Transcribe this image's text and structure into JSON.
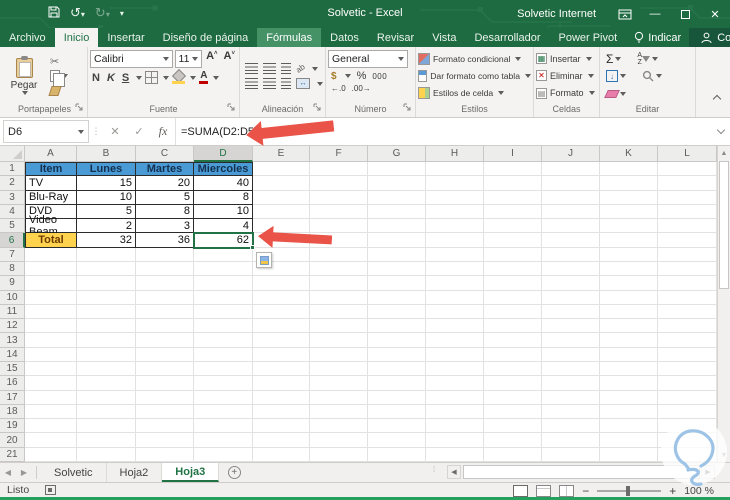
{
  "titlebar": {
    "title": "Solvetic - Excel",
    "account": "Solvetic Internet"
  },
  "ribbon_tabs": [
    {
      "label": "Archivo",
      "state": "file"
    },
    {
      "label": "Inicio",
      "state": "active"
    },
    {
      "label": "Insertar",
      "state": "normal"
    },
    {
      "label": "Diseño de página",
      "state": "normal"
    },
    {
      "label": "Fórmulas",
      "state": "highlight"
    },
    {
      "label": "Datos",
      "state": "normal"
    },
    {
      "label": "Revisar",
      "state": "normal"
    },
    {
      "label": "Vista",
      "state": "normal"
    },
    {
      "label": "Desarrollador",
      "state": "normal"
    },
    {
      "label": "Power Pivot",
      "state": "normal"
    }
  ],
  "tell_me": "Indicar",
  "share": "Compartir",
  "ribbon": {
    "clipboard": {
      "paste": "Pegar",
      "label": "Portapapeles"
    },
    "font": {
      "family": "Calibri",
      "size": "11",
      "bold": "N",
      "italic": "K",
      "underline": "S",
      "label": "Fuente"
    },
    "alignment": {
      "label": "Alineación"
    },
    "number": {
      "format": "General",
      "label": "Número"
    },
    "styles": {
      "items": [
        "Formato condicional",
        "Dar formato como tabla",
        "Estilos de celda"
      ],
      "label": "Estilos"
    },
    "cells": {
      "items": [
        "Insertar",
        "Eliminar",
        "Formato"
      ],
      "label": "Celdas"
    },
    "editing": {
      "label": "Editar"
    }
  },
  "formula_bar": {
    "name_box": "D6",
    "fx_label": "fx",
    "formula": "=SUMA(D2:D5)"
  },
  "sheet": {
    "columns": [
      "A",
      "B",
      "C",
      "D",
      "E",
      "F",
      "G",
      "H",
      "I",
      "J",
      "K",
      "L"
    ],
    "visible_rows": 21,
    "selected_column": "D",
    "selected_row": 6,
    "table": {
      "headers": [
        "Item",
        "Lunes",
        "Martes",
        "Miercoles"
      ],
      "rows": [
        [
          "TV",
          "15",
          "20",
          "40"
        ],
        [
          "Blu-Ray",
          "10",
          "5",
          "8"
        ],
        [
          "DVD",
          "5",
          "8",
          "10"
        ],
        [
          "Video Beam",
          "2",
          "3",
          "4"
        ]
      ],
      "total_row": [
        "Total",
        "32",
        "36",
        "62"
      ]
    }
  },
  "sheet_tabs": {
    "tabs": [
      "Solvetic",
      "Hoja2",
      "Hoja3"
    ],
    "active": "Hoja3"
  },
  "status_bar": {
    "ready": "Listo",
    "zoom": "100 %"
  },
  "colors": {
    "excel_green": "#217346",
    "titlebar_green": "#1e6b41",
    "header_blue": "#4a9bd5",
    "total_yellow": "#ffd34d",
    "arrow_red": "#e95348"
  }
}
